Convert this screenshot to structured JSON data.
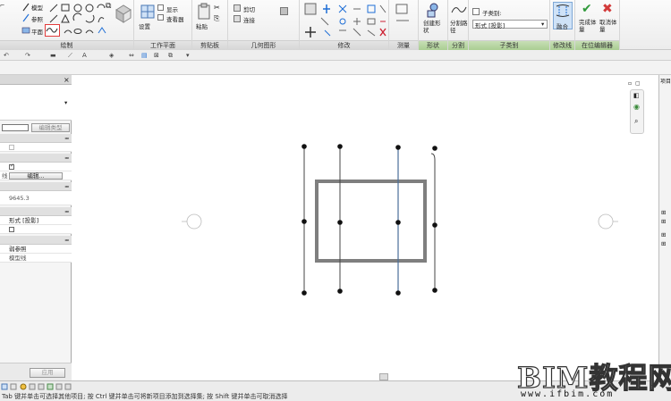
{
  "ribbon": {
    "draw_panel": {
      "title": "绘制",
      "model_label": "模型",
      "reference_label": "参照",
      "plane_label": "平面"
    },
    "workplane_panel": {
      "title": "工作平面",
      "set_label": "设置",
      "show_label": "显示",
      "viewer_label": "查看器"
    },
    "clipboard_panel": {
      "title": "剪贴板",
      "paste_label": "粘贴"
    },
    "geometry_panel": {
      "title": "几何图形",
      "cut_label": "剪切",
      "join_label": "连接"
    },
    "modify_panel": {
      "title": "修改"
    },
    "measure_panel": {
      "title": "测量"
    },
    "form_panel": {
      "title": "形状",
      "create_form_label": "创建形状"
    },
    "divide_panel": {
      "title": "分割",
      "divide_path_label": "分割路径"
    },
    "subcategory_panel": {
      "title": "子类别",
      "label": "子类别:",
      "value": "形式 [投影]"
    },
    "modeline_panel": {
      "title": "修改线",
      "blend_label": "融合"
    },
    "inplace_panel": {
      "title": "在位编辑器",
      "finish_label": "完成体量",
      "cancel_label": "取消体量"
    }
  },
  "properties": {
    "edit_type_label": "编辑类型",
    "edit_button_label": "编辑...",
    "row_label_fragment": "线",
    "elevation_value": "9645.3",
    "subcategory_value": "形式 [投影]",
    "reference_label": "弱参照",
    "line_style_value": "模型线",
    "apply_label": "应用"
  },
  "right_panel": {
    "title_fragment": "项目"
  },
  "status": {
    "hint": "Tab 键并单击可选择其他项目; 按 Ctrl 键并单击可将新项目添加到选择集; 按 Shift 键并单击可取消选择"
  },
  "watermark": {
    "main": "BIM教程网",
    "url": "www.ifbim.com"
  },
  "colors": {
    "highlight_red": "#e23b3b",
    "finish_green": "#2f9a3a",
    "cancel_red": "#d23a3a",
    "rectangle": "#7f7f7f",
    "blue_line": "#4a6f9a"
  }
}
